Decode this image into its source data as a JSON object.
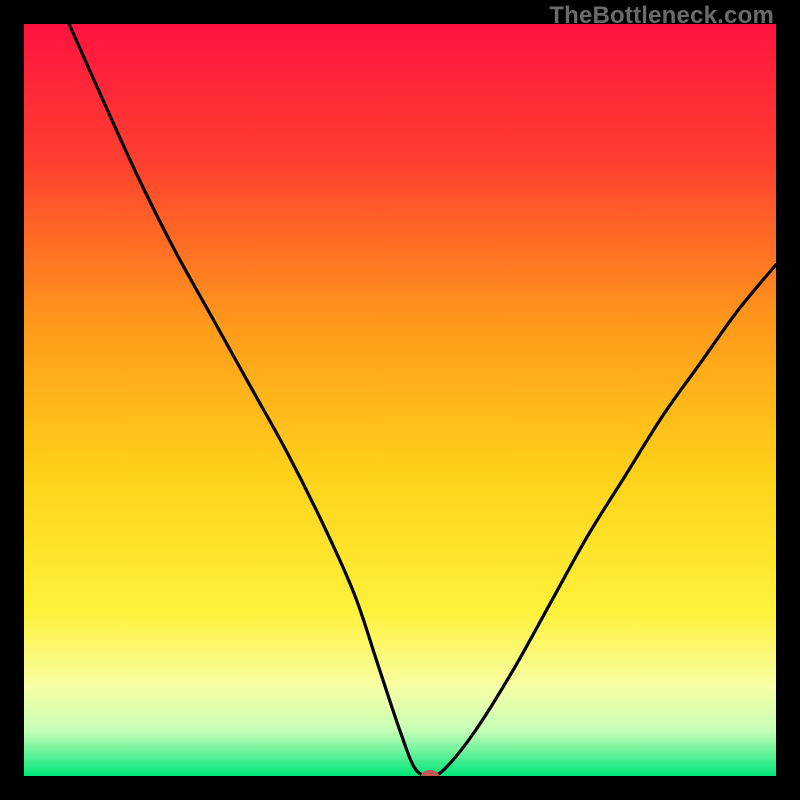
{
  "watermark": "TheBottleneck.com",
  "chart_data": {
    "type": "line",
    "title": "",
    "xlabel": "",
    "ylabel": "",
    "xlim": [
      0,
      100
    ],
    "ylim": [
      0,
      100
    ],
    "grid": false,
    "legend": false,
    "gradient_stops": [
      {
        "offset": 0.0,
        "color": "#ff1440"
      },
      {
        "offset": 0.18,
        "color": "#ff3e2f"
      },
      {
        "offset": 0.4,
        "color": "#ff9a1a"
      },
      {
        "offset": 0.6,
        "color": "#ffd21a"
      },
      {
        "offset": 0.78,
        "color": "#fff23a"
      },
      {
        "offset": 0.88,
        "color": "#f8ffa3"
      },
      {
        "offset": 0.94,
        "color": "#c6ffb7"
      },
      {
        "offset": 1.0,
        "color": "#00e67a"
      }
    ],
    "series": [
      {
        "name": "bottleneck-curve",
        "x": [
          6,
          10,
          15,
          20,
          25,
          30,
          35,
          40,
          44,
          47,
          50,
          52,
          54,
          56,
          60,
          65,
          70,
          75,
          80,
          85,
          90,
          95,
          100
        ],
        "y": [
          100,
          91,
          80,
          70,
          61,
          52,
          43,
          33,
          24,
          15,
          6,
          1,
          0,
          1,
          6,
          14,
          23,
          32,
          40,
          48,
          55,
          62,
          68
        ]
      }
    ],
    "flat_region": {
      "x_from": 50,
      "x_to": 55,
      "y": 0
    },
    "marker": {
      "x": 54,
      "y": 0,
      "color": "#c45a53",
      "rx": 9,
      "ry": 6
    }
  }
}
